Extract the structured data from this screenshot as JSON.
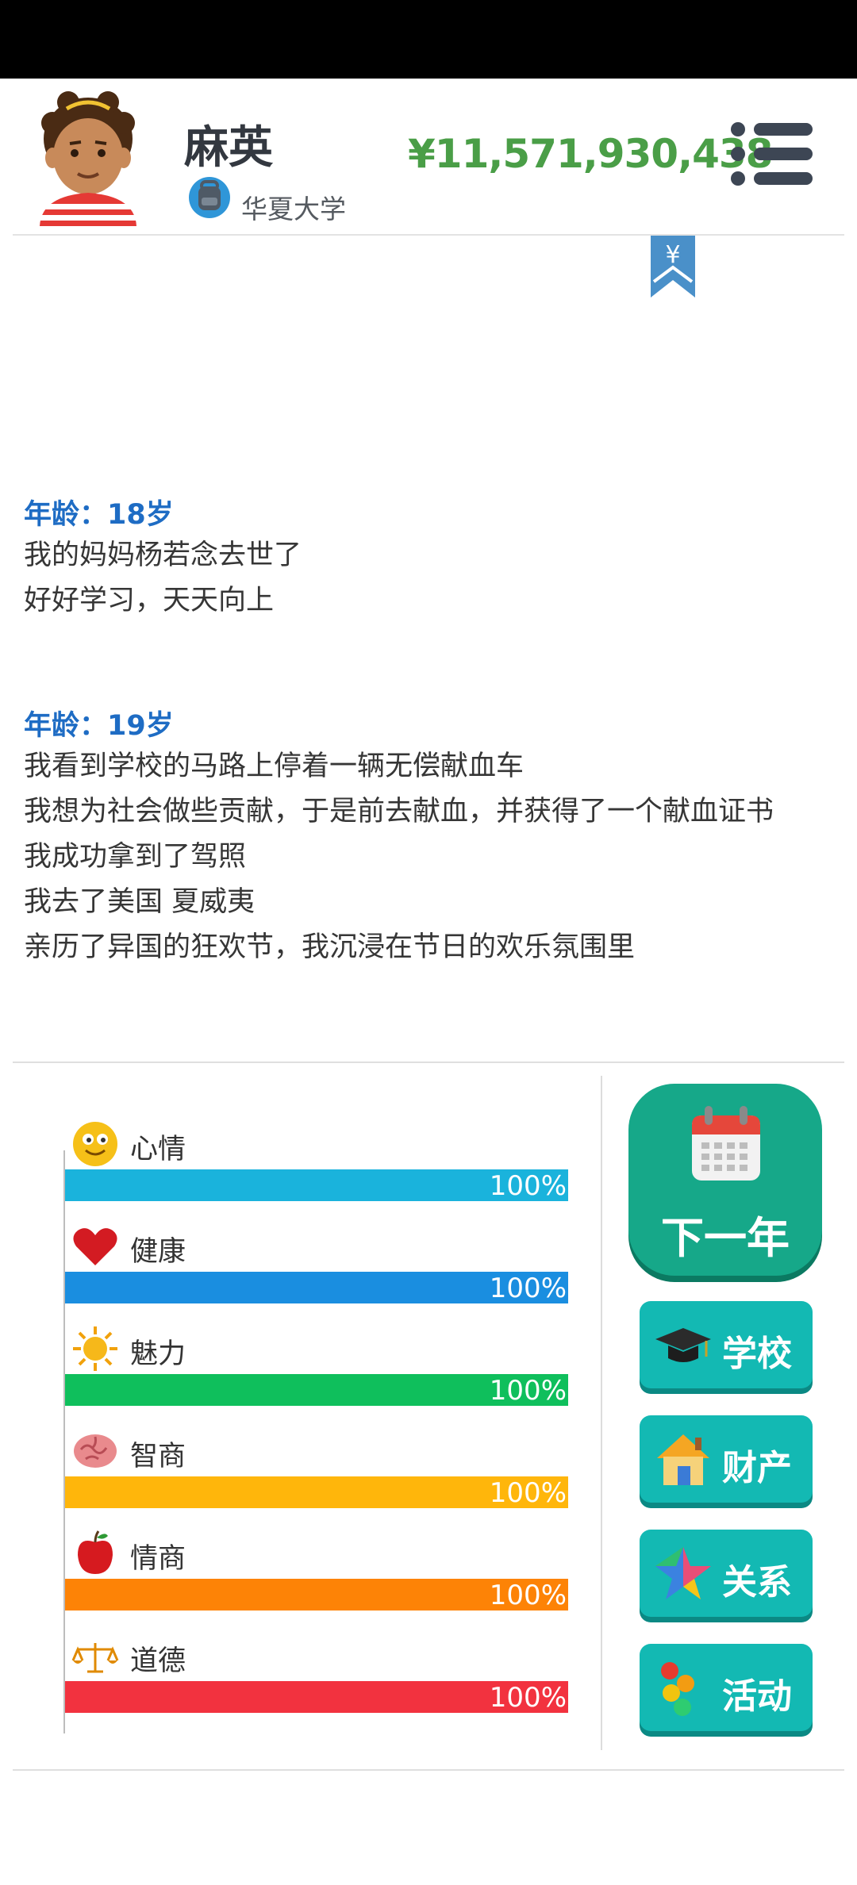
{
  "header": {
    "name": "麻英",
    "school": "华夏大学",
    "money": "¥11,571,930,438"
  },
  "bookmark_symbol": "¥",
  "log": [
    {
      "age": "年龄：18岁",
      "events": [
        "我的妈妈杨若念去世了",
        "好好学习，天天向上"
      ]
    },
    {
      "age": "年龄：19岁",
      "events": [
        "我看到学校的马路上停着一辆无偿献血车",
        "我想为社会做些贡献，于是前去献血，并获得了一个献血证书",
        "我成功拿到了驾照",
        "我去了美国 夏威夷",
        "亲历了异国的狂欢节，我沉浸在节日的欢乐氛围里"
      ]
    }
  ],
  "stats": [
    {
      "label": "心情",
      "percent": 100,
      "display": "100%",
      "color": "#1ab3dc",
      "icon": "smiley-icon"
    },
    {
      "label": "健康",
      "percent": 100,
      "display": "100%",
      "color": "#1a8ee0",
      "icon": "heart-icon"
    },
    {
      "label": "魅力",
      "percent": 100,
      "display": "100%",
      "color": "#0fbf5c",
      "icon": "sun-icon"
    },
    {
      "label": "智商",
      "percent": 100,
      "display": "100%",
      "color": "#ffb60b",
      "icon": "brain-icon"
    },
    {
      "label": "情商",
      "percent": 100,
      "display": "100%",
      "color": "#fd8306",
      "icon": "apple-icon"
    },
    {
      "label": "道德",
      "percent": 100,
      "display": "100%",
      "color": "#f2323f",
      "icon": "scales-icon"
    }
  ],
  "actions": {
    "next_year": "下一年",
    "school": "学校",
    "assets": "财产",
    "relations": "关系",
    "activities": "活动"
  }
}
